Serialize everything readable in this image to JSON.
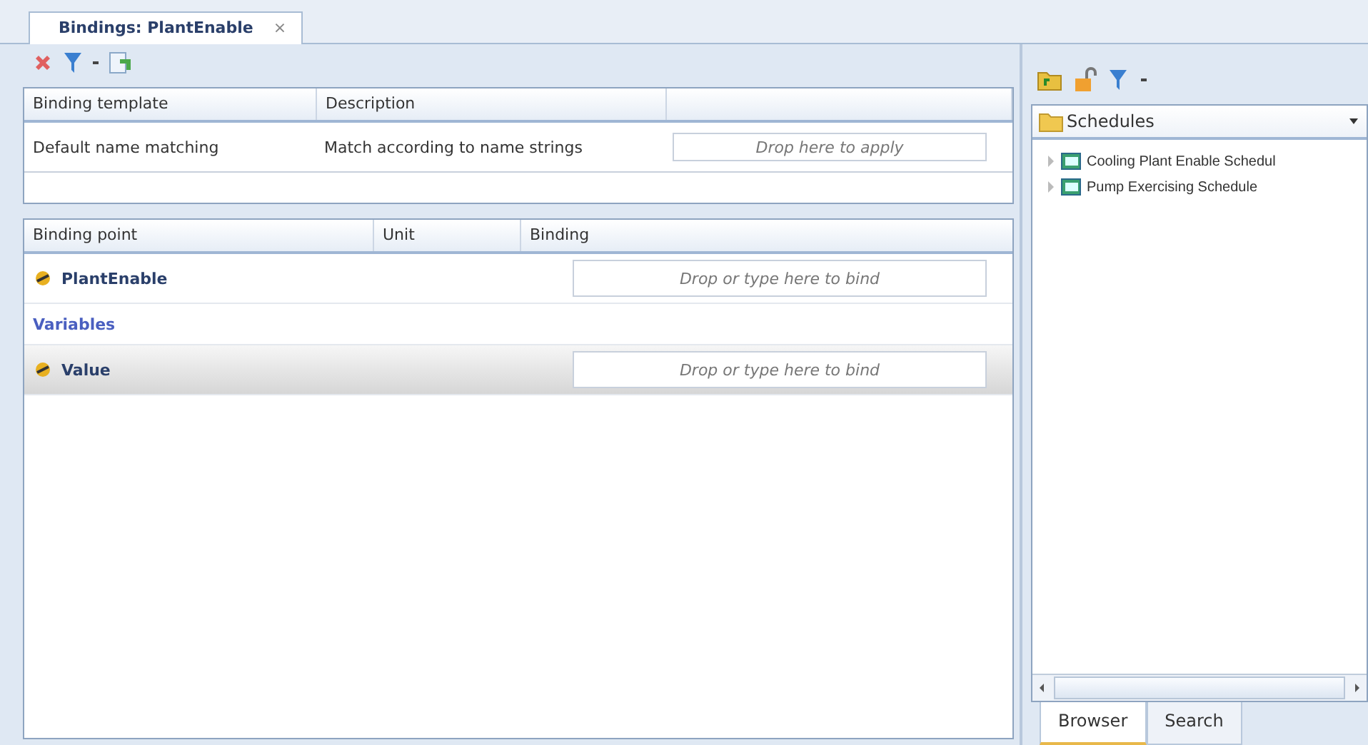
{
  "document_tab": {
    "label": "Bindings: PlantEnable",
    "close": "×"
  },
  "template_table": {
    "columns": [
      "Binding template",
      "Description"
    ],
    "rows": [
      {
        "template": "Default name matching",
        "description": "Match according to name strings",
        "drop_placeholder": "Drop here to apply"
      }
    ]
  },
  "binding_table": {
    "columns": [
      "Binding point",
      "Unit",
      "Binding"
    ],
    "rows": [
      {
        "kind": "point",
        "name": "PlantEnable",
        "placeholder": "Drop or type here to bind",
        "selected": false
      },
      {
        "kind": "section",
        "name": "Variables"
      },
      {
        "kind": "point",
        "name": "Value",
        "placeholder": "Drop or type here to bind",
        "selected": true
      }
    ]
  },
  "browser": {
    "location": "Schedules",
    "items": [
      {
        "label": "Cooling Plant Enable Schedul",
        "expanded": false
      },
      {
        "label": "Pump Exercising Schedule",
        "expanded": false
      }
    ]
  },
  "bottom_tabs": [
    {
      "label": "Browser",
      "selected": true
    },
    {
      "label": "Search",
      "selected": false
    }
  ]
}
